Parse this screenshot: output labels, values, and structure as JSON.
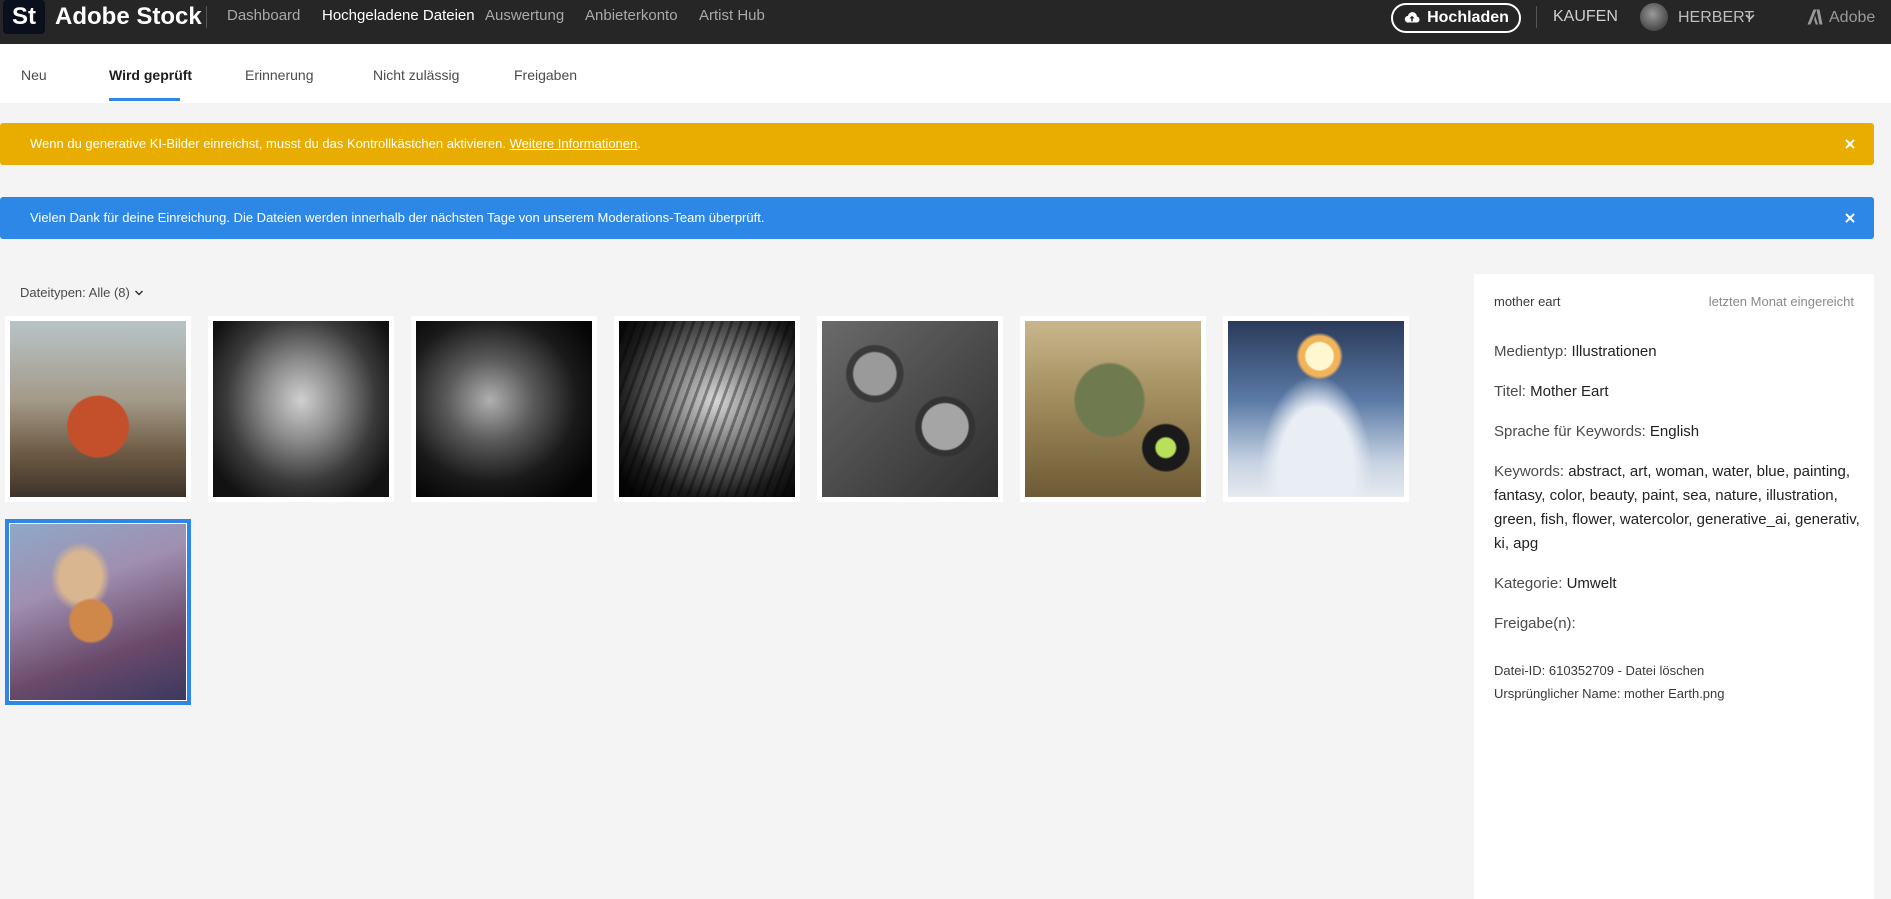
{
  "app": {
    "logo_text": "St",
    "brand": "Adobe Stock"
  },
  "nav": {
    "items": [
      {
        "label": "Dashboard"
      },
      {
        "label": "Hochgeladene Dateien"
      },
      {
        "label": "Auswertung"
      },
      {
        "label": "Anbieterkonto"
      },
      {
        "label": "Artist Hub"
      }
    ],
    "active": "Hochgeladene Dateien",
    "upload_label": "Hochladen",
    "buy_label": "KAUFEN",
    "user_name": "HERBERT",
    "adobe_label": "Adobe"
  },
  "tabs": {
    "items": [
      {
        "label": "Neu"
      },
      {
        "label": "Wird geprüft"
      },
      {
        "label": "Erinnerung"
      },
      {
        "label": "Nicht zulässig"
      },
      {
        "label": "Freigaben"
      }
    ],
    "active": "Wird geprüft"
  },
  "banners": {
    "warning": {
      "text": "Wenn du generative KI-Bilder einreichst, musst du das Kontrollkästchen aktivieren.",
      "link": "Weitere Informationen",
      "suffix": ".",
      "color": "#e8ad00"
    },
    "info": {
      "text": "Vielen Dank für deine Einreichung. Die Dateien werden innerhalb der nächsten Tage von unserem Moderations-Team überprüft.",
      "color": "#2d87e6"
    }
  },
  "filter": {
    "label": "Dateitypen: Alle (8)"
  },
  "thumbnails": [
    {
      "name": "collage-globe-people",
      "selected": false
    },
    {
      "name": "elephant-bw",
      "selected": false
    },
    {
      "name": "lion-bw",
      "selected": false
    },
    {
      "name": "tiger-bw",
      "selected": false
    },
    {
      "name": "gears-machinery-bw",
      "selected": false
    },
    {
      "name": "frog-camera",
      "selected": false
    },
    {
      "name": "figure-clouds-halo",
      "selected": false
    },
    {
      "name": "mother-earth-painting",
      "selected": true
    }
  ],
  "details": {
    "file_name": "mother eart",
    "submitted": "letzten Monat eingereicht",
    "media_type_label": "Medientyp:",
    "media_type": "Illustrationen",
    "title_label": "Titel:",
    "title": "Mother Eart",
    "language_label": "Sprache für Keywords:",
    "language": "English",
    "keywords_label": "Keywords:",
    "keywords": "abstract, art, woman, water, blue, painting, fantasy, color, beauty, paint, sea, nature, illustration, green, fish, flower, watercolor, generative_ai, generativ, ki, apg",
    "category_label": "Kategorie:",
    "category": "Umwelt",
    "releases_label": "Freigabe(n):",
    "file_id_line": "Datei-ID: 610352709 - Datei löschen",
    "original_name_line": "Ursprünglicher Name: mother Earth.png"
  },
  "colors": {
    "topbar": "#262626",
    "accent": "#2d87e6",
    "warning": "#e8ad00"
  }
}
